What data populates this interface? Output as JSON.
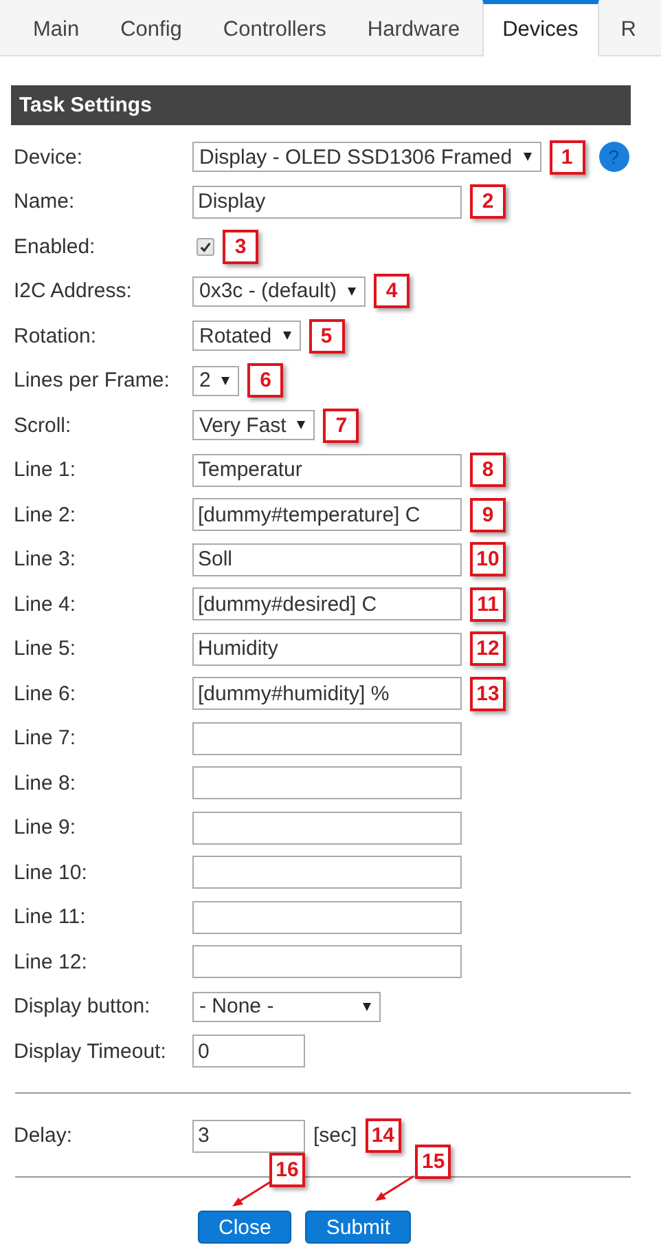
{
  "tabs": [
    {
      "label": "Main",
      "selected": false
    },
    {
      "label": "Config",
      "selected": false
    },
    {
      "label": "Controllers",
      "selected": false
    },
    {
      "label": "Hardware",
      "selected": false
    },
    {
      "label": "Devices",
      "selected": true
    },
    {
      "label": "R",
      "selected": false
    }
  ],
  "section_title": "Task Settings",
  "fields": [
    {
      "kind": "select",
      "label": "Device:",
      "value": "Display - OLED SSD1306 Framed",
      "callout": "1",
      "help": "?"
    },
    {
      "kind": "text",
      "label": "Name:",
      "value": "Display",
      "callout": "2"
    },
    {
      "kind": "checkbox",
      "label": "Enabled:",
      "checked": true,
      "callout": "3"
    },
    {
      "kind": "select",
      "label": "I2C Address:",
      "value": "0x3c - (default)",
      "callout": "4"
    },
    {
      "kind": "select",
      "label": "Rotation:",
      "value": "Rotated",
      "callout": "5"
    },
    {
      "kind": "select",
      "label": "Lines per Frame:",
      "value": "2",
      "callout": "6"
    },
    {
      "kind": "select",
      "label": "Scroll:",
      "value": "Very Fast",
      "callout": "7"
    },
    {
      "kind": "text",
      "label": "Line 1:",
      "value": "Temperatur",
      "callout": "8"
    },
    {
      "kind": "text",
      "label": "Line 2:",
      "value": "[dummy#temperature] C",
      "callout": "9"
    },
    {
      "kind": "text",
      "label": "Line 3:",
      "value": "Soll",
      "callout": "10"
    },
    {
      "kind": "text",
      "label": "Line 4:",
      "value": "[dummy#desired] C",
      "callout": "11"
    },
    {
      "kind": "text",
      "label": "Line 5:",
      "value": "Humidity",
      "callout": "12"
    },
    {
      "kind": "text",
      "label": "Line 6:",
      "value": "[dummy#humidity] %",
      "callout": "13"
    },
    {
      "kind": "text",
      "label": "Line 7:"
    },
    {
      "kind": "text",
      "label": "Line 8:"
    },
    {
      "kind": "text",
      "label": "Line 9:"
    },
    {
      "kind": "text",
      "label": "Line 10:"
    },
    {
      "kind": "text",
      "label": "Line 11:"
    },
    {
      "kind": "text",
      "label": "Line 12:"
    },
    {
      "kind": "wide-select",
      "label": "Display button:",
      "value": "- None -"
    },
    {
      "kind": "number",
      "label": "Display Timeout:",
      "value": "0"
    }
  ],
  "delay": {
    "label": "Delay:",
    "value": "3",
    "unit": "[sec]",
    "callout": "14"
  },
  "buttons": [
    {
      "label": "Close",
      "callout": "16"
    },
    {
      "label": "Submit",
      "callout": "15"
    }
  ]
}
